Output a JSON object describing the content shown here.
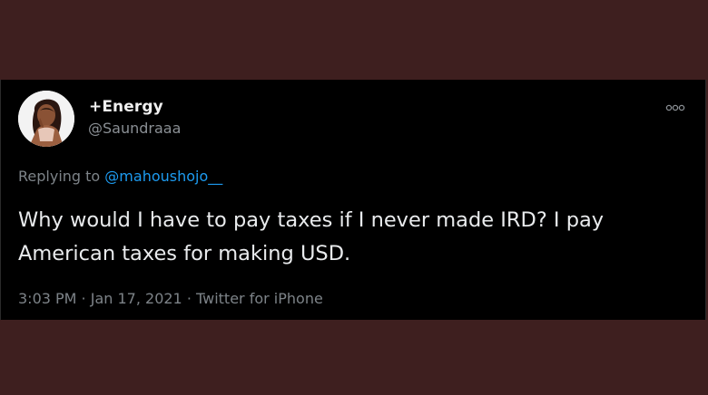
{
  "tweet": {
    "author": {
      "display_name": "+Energy",
      "handle": "@Saundraaa",
      "avatar_icon": "profile-photo"
    },
    "more_icon": "more-options-icon",
    "reply": {
      "prefix": "Replying to ",
      "mention": "@mahoushojo__"
    },
    "text": "Why would I have to pay taxes if I never made IRD? I pay American taxes for making USD.",
    "time": "3:03 PM",
    "separator": " · ",
    "date": "Jan 17, 2021",
    "source": "Twitter for iPhone"
  },
  "colors": {
    "outer_background": "#3e1f1f",
    "card_background": "#000000",
    "mention_accent": "#1d9bf0",
    "secondary_text": "#7d8388"
  }
}
